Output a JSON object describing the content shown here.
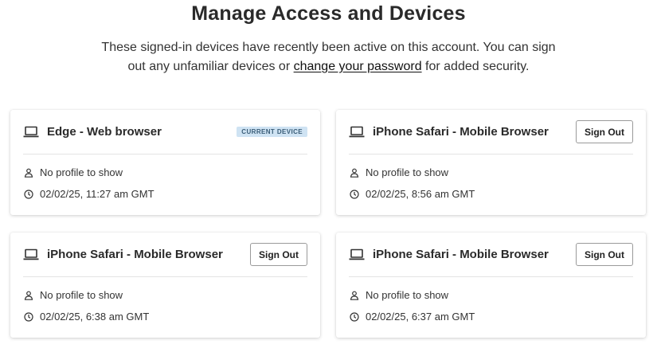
{
  "page": {
    "title": "Manage Access and Devices",
    "intro_line1": "These signed-in devices have recently been active on this account. You can sign",
    "intro_line2_before": "out any unfamiliar devices or ",
    "intro_link": "change your password",
    "intro_line2_after": " for added security."
  },
  "devices": [
    {
      "name": "Edge - Web browser",
      "badge": "CURRENT DEVICE",
      "profile": "No profile to show",
      "last_active": "02/02/25, 11:27 am GMT"
    },
    {
      "name": "iPhone Safari - Mobile Browser",
      "action_label": "Sign Out",
      "profile": "No profile to show",
      "last_active": "02/02/25, 8:56 am GMT"
    },
    {
      "name": "iPhone Safari - Mobile Browser",
      "action_label": "Sign Out",
      "profile": "No profile to show",
      "last_active": "02/02/25, 6:38 am GMT"
    },
    {
      "name": "iPhone Safari - Mobile Browser",
      "action_label": "Sign Out",
      "profile": "No profile to show",
      "last_active": "02/02/25, 6:37 am GMT"
    }
  ],
  "icons": {
    "device": "laptop-icon",
    "profile": "person-icon",
    "time": "clock-icon"
  },
  "colors": {
    "badge_background": "#cfe3f3",
    "badge_text": "#3a5d78"
  }
}
